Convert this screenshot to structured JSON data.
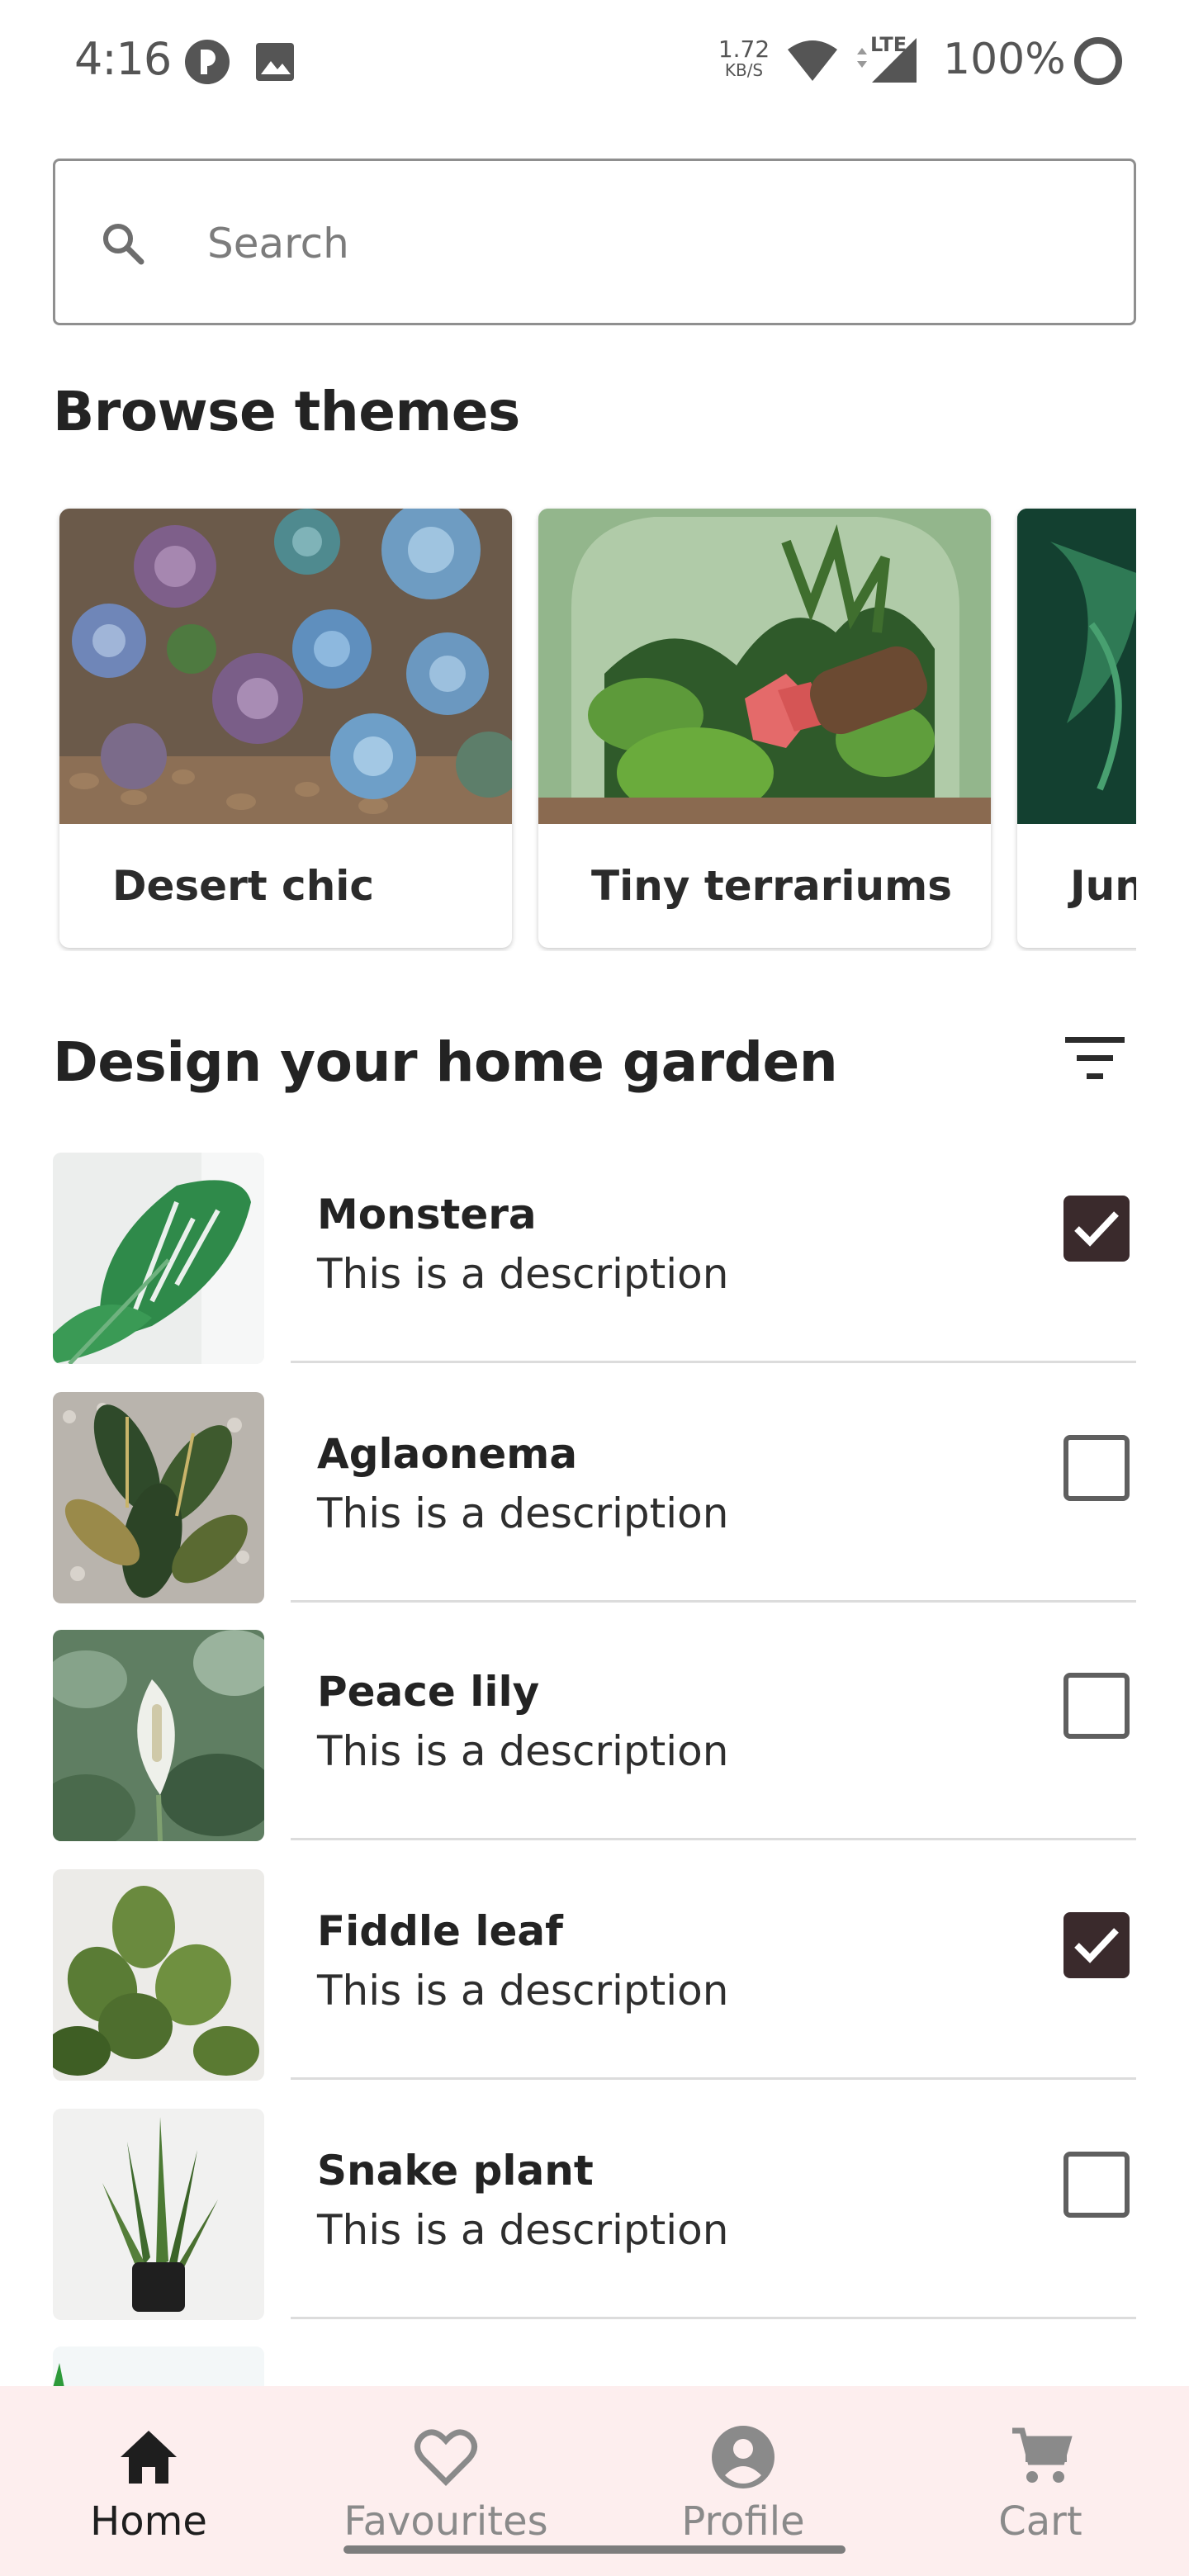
{
  "status_bar": {
    "time": "4:16",
    "speed_value": "1.72",
    "speed_unit": "KB/S",
    "network": "LTE",
    "battery": "100%"
  },
  "search": {
    "placeholder": "Search",
    "value": ""
  },
  "browse": {
    "title": "Browse themes",
    "themes": [
      {
        "label": "Desert chic"
      },
      {
        "label": "Tiny terrariums"
      },
      {
        "label": "Jun"
      }
    ]
  },
  "garden": {
    "title": "Design your home garden",
    "items": [
      {
        "name": "Monstera",
        "description": "This is a description",
        "checked": true
      },
      {
        "name": "Aglaonema",
        "description": "This is a description",
        "checked": false
      },
      {
        "name": "Peace lily",
        "description": "This is a description",
        "checked": false
      },
      {
        "name": "Fiddle leaf",
        "description": "This is a description",
        "checked": true
      },
      {
        "name": "Snake plant",
        "description": "This is a description",
        "checked": false
      }
    ]
  },
  "nav": {
    "items": [
      {
        "label": "Home",
        "icon": "home-icon",
        "active": true
      },
      {
        "label": "Favourites",
        "icon": "heart-icon",
        "active": false
      },
      {
        "label": "Profile",
        "icon": "account-icon",
        "active": false
      },
      {
        "label": "Cart",
        "icon": "cart-icon",
        "active": false
      }
    ]
  },
  "colors": {
    "checkbox_checked": "#3a2a2c",
    "nav_background": "#fdeeee"
  }
}
